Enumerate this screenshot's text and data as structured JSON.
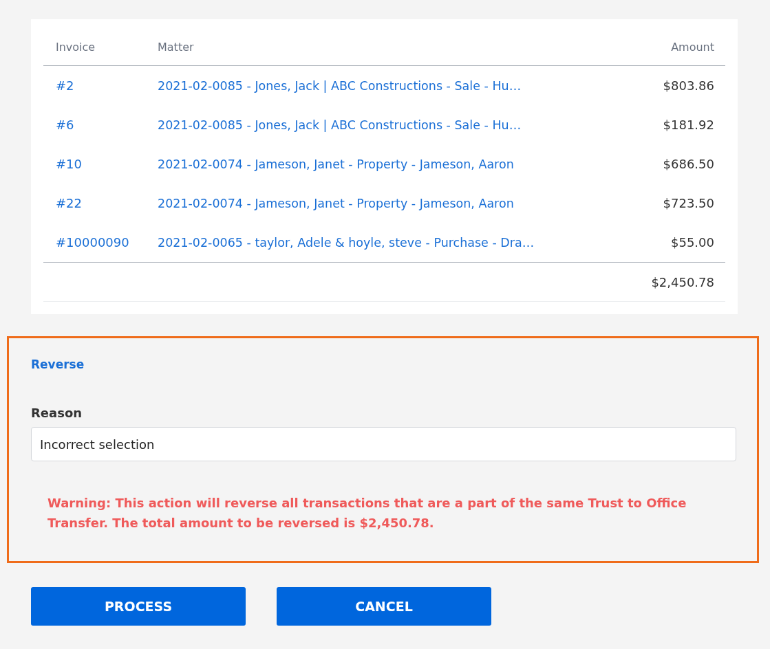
{
  "table": {
    "columns": [
      "Invoice",
      "Matter",
      "Amount"
    ],
    "rows": [
      {
        "invoice": "#2",
        "matter": "2021-02-0085 - Jones, Jack | ABC Constructions - Sale - Hu…",
        "amount": "$803.86"
      },
      {
        "invoice": "#6",
        "matter": "2021-02-0085 - Jones, Jack | ABC Constructions - Sale - Hu…",
        "amount": "$181.92"
      },
      {
        "invoice": "#10",
        "matter": "2021-02-0074 - Jameson, Janet - Property - Jameson, Aaron",
        "amount": "$686.50"
      },
      {
        "invoice": "#22",
        "matter": "2021-02-0074 - Jameson, Janet - Property - Jameson, Aaron",
        "amount": "$723.50"
      },
      {
        "invoice": "#10000090",
        "matter": "2021-02-0065 - taylor, Adele & hoyle, steve - Purchase - Dra…",
        "amount": "$55.00"
      }
    ],
    "total": "$2,450.78"
  },
  "reverse": {
    "title": "Reverse",
    "reason_label": "Reason",
    "reason_value": "Incorrect selection",
    "warning": "Warning: This action will reverse all transactions that are a part of the same Trust to Office Transfer. The total amount to be reversed is $2,450.78."
  },
  "buttons": [
    "PROCESS",
    "CANCEL"
  ]
}
